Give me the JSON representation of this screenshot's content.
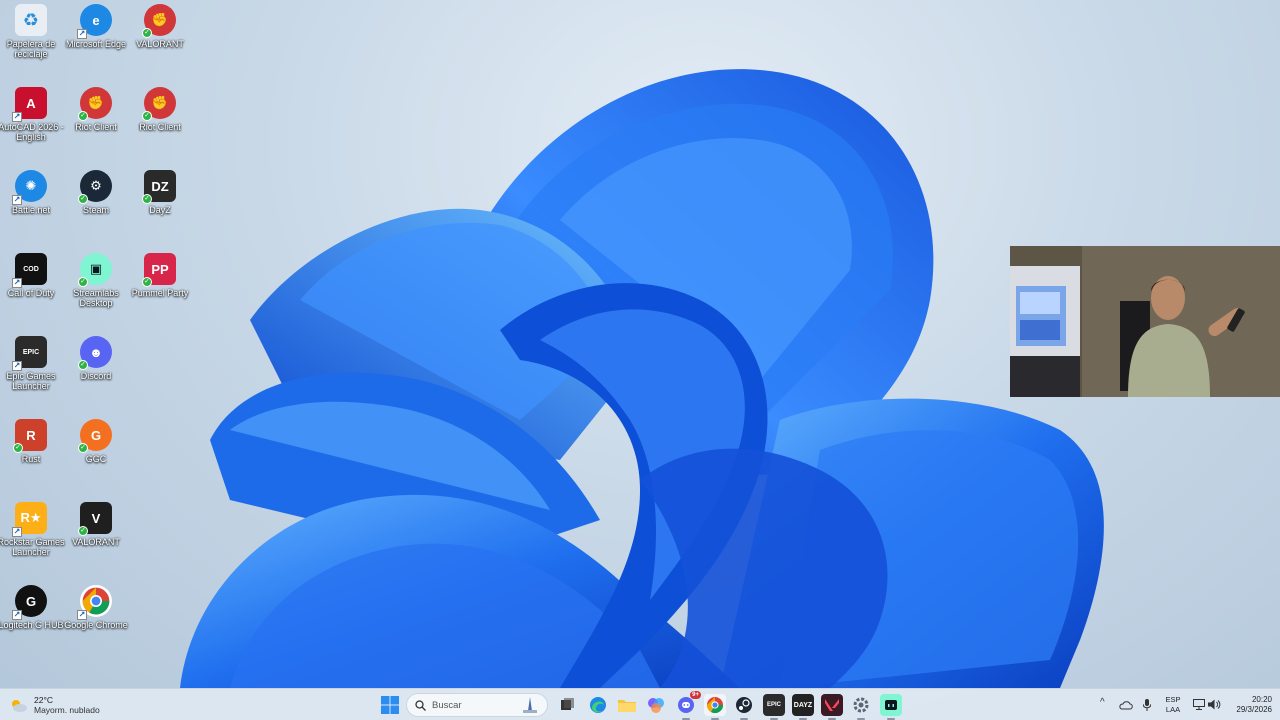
{
  "desktop": {
    "icons": [
      {
        "label": "Papelera de reciclaje",
        "icon": "recycle-bin-icon",
        "color": "#e8eef4"
      },
      {
        "label": "Microsoft Edge",
        "icon": "edge-icon",
        "color": "#1e88e5"
      },
      {
        "label": "VALORANT",
        "icon": "riot-fist-icon",
        "color": "#d13639"
      },
      {
        "label": "AutoCAD 2026 - English",
        "icon": "autocad-icon",
        "color": "#c8102e"
      },
      {
        "label": "Riot Client",
        "icon": "riot-fist-icon",
        "color": "#d13639"
      },
      {
        "label": "Riot Client",
        "icon": "riot-fist-icon",
        "color": "#d13639"
      },
      {
        "label": "Battle.net",
        "icon": "battlenet-icon",
        "color": "#1e88e5"
      },
      {
        "label": "Steam",
        "icon": "steam-icon",
        "color": "#1b2838"
      },
      {
        "label": "DayZ",
        "icon": "dayz-icon",
        "color": "#2a2a2a"
      },
      {
        "label": "Call of Duty",
        "icon": "call-of-duty-icon",
        "color": "#111111"
      },
      {
        "label": "Streamlabs Desktop",
        "icon": "streamlabs-icon",
        "color": "#80f5d2"
      },
      {
        "label": "Pummel Party",
        "icon": "pummel-party-icon",
        "color": "#d8254a"
      },
      {
        "label": "Epic Games Launcher",
        "icon": "epic-games-icon",
        "color": "#2b2b2b"
      },
      {
        "label": "Discord",
        "icon": "discord-icon",
        "color": "#5865f2"
      },
      {
        "label": "Rust",
        "icon": "rust-icon",
        "color": "#cd412b"
      },
      {
        "label": "GGC",
        "icon": "ggc-icon",
        "color": "#f37021"
      },
      {
        "label": "Rockstar Games Launcher",
        "icon": "rockstar-icon",
        "color": "#fcaf17"
      },
      {
        "label": "VALORANT",
        "icon": "valorant-icon",
        "color": "#1f1f1f"
      },
      {
        "label": "Logitech G HUB",
        "icon": "logitech-g-icon",
        "color": "#111111"
      },
      {
        "label": "Google Chrome",
        "icon": "chrome-icon",
        "color": "#ffffff"
      }
    ]
  },
  "taskbar": {
    "weather": {
      "temp": "22°C",
      "condition": "Mayorm. nublado"
    },
    "search_placeholder": "Buscar",
    "apps": [
      "start-icon",
      "search-icon",
      "task-view-icon",
      "edge-icon",
      "file-explorer-icon",
      "copilot-icon",
      "discord-icon",
      "chrome-icon",
      "steam-icon",
      "epic-games-icon",
      "dayz-icon",
      "valorant-icon",
      "settings-icon",
      "streamlabs-icon"
    ],
    "discord_badge": "9+",
    "language": {
      "line1": "ESP",
      "line2": "LAA"
    },
    "clock": {
      "time": "20:20",
      "date": "29/3/2026"
    }
  }
}
